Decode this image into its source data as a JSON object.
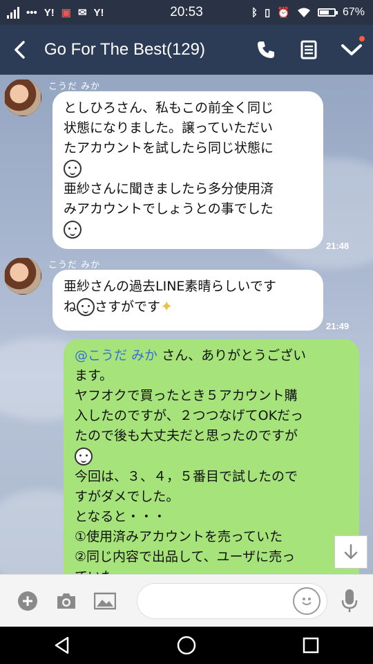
{
  "status_bar": {
    "time": "20:53",
    "battery_percent": "67%",
    "notif_icons": [
      "Y!",
      "Y!"
    ]
  },
  "header": {
    "title": "Go For The Best(129)"
  },
  "messages": [
    {
      "sender": "こうだ みか",
      "time": "21:48",
      "lines": [
        "としひろさん、私もこの前全く同じ",
        "状態になりました。譲っていただい",
        "たアカウントを試したら同じ状態に",
        "亜紗さんに聞きましたら多分使用済",
        "みアカウントでしょうとの事でした"
      ]
    },
    {
      "sender": "こうだ みか",
      "time": "21:49",
      "lines": [
        "亜紗さんの過去LINE素晴らしいです",
        "ね",
        "さすがです"
      ]
    },
    {
      "mention": "@こうだ みか",
      "lines": [
        " さん、ありがとうござい",
        "ます。",
        "ヤフオクで買ったとき５アカウント購",
        "入したのですが、２つつなげてOKだっ",
        "たので後も大丈夫だと思ったのですが",
        "今回は、３、４，５番目で試したので",
        "すがダメでした。",
        "となると・・・",
        "①使用済みアカウントを売っていた",
        "②同じ内容で出品して、ユーザに売っ",
        "ていた"
      ]
    }
  ],
  "input": {
    "placeholder": "",
    "value": ""
  },
  "colors": {
    "header": "#2d3c56",
    "outgoing_bubble": "#a6e47b",
    "incoming_bubble": "#ffffff",
    "mention": "#3a6fd6"
  }
}
